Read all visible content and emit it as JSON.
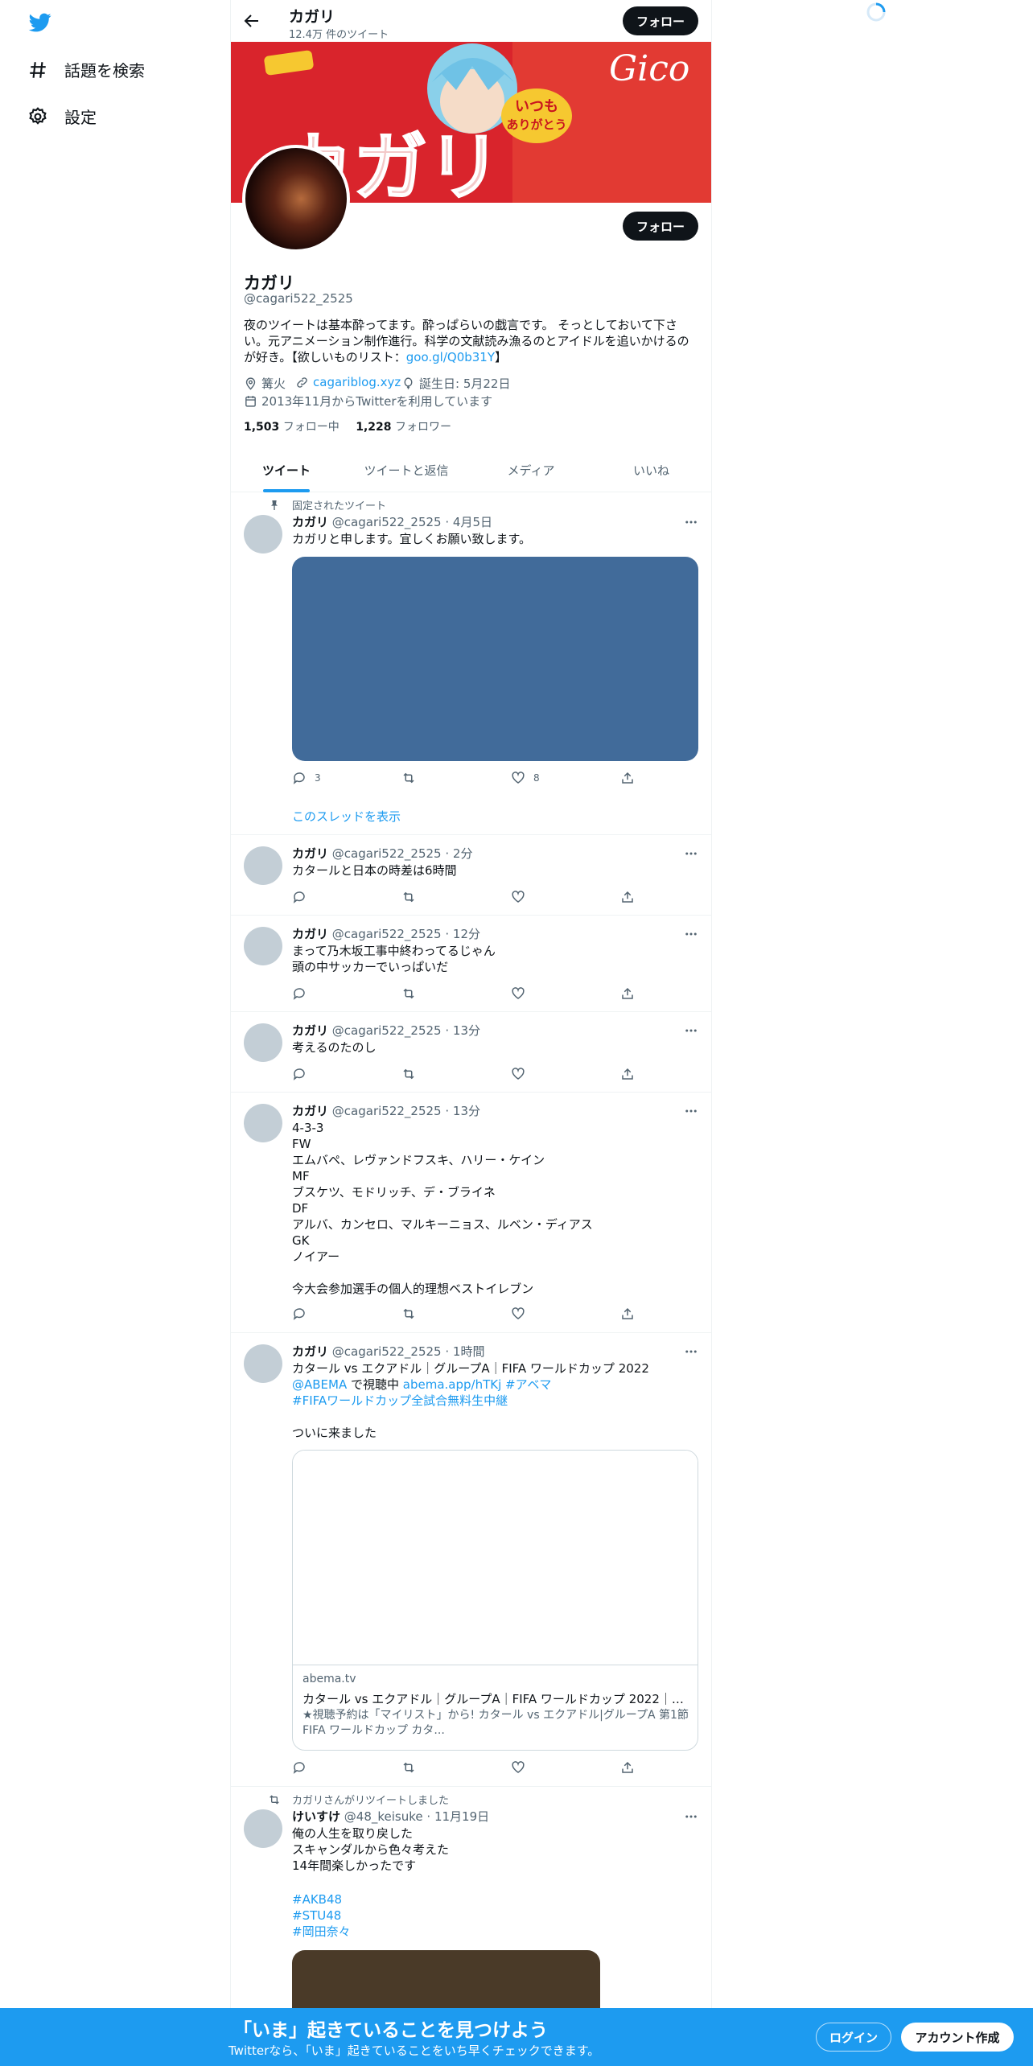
{
  "nav": {
    "explore_label": "話題を検索",
    "settings_label": "設定"
  },
  "header": {
    "name": "カガリ",
    "tweet_count": "12.4万 件のツイート",
    "follow_label": "フォロー"
  },
  "profile": {
    "name": "カガリ",
    "handle": "@cagari522_2525",
    "bio_text": "夜のツイートは基本酔ってます。酔っぱらいの戯言です。 そっとしておいて下さい。元アニメーション制作進行。科学の文献読み漁るのとアイドルを追いかけるのが好き。【欲しいものリスト：",
    "bio_link": "goo.gl/Q0b31Y",
    "bio_end": "】",
    "location": "篝火",
    "url": "cagariblog.xyz",
    "birthday": "誕生日: 5月22日",
    "joined": "2013年11月からTwitterを利用しています",
    "following_count": "1,503",
    "following_label": " フォロー中",
    "followers_count": "1,228",
    "followers_label": " フォロワー",
    "follow_label": "フォロー"
  },
  "tabs": [
    "ツイート",
    "ツイートと返信",
    "メディア",
    "いいね"
  ],
  "tweets": [
    {
      "context": "固定されたツイート",
      "name": "カガリ",
      "handle": "@cagari522_2525",
      "time": "4月5日",
      "text": "カガリと申します。宜しくお願い致します。",
      "replies": "3",
      "likes": "8",
      "thread_link": "このスレッドを表示"
    },
    {
      "name": "カガリ",
      "handle": "@cagari522_2525",
      "time": "2分",
      "text": "カタールと日本の時差は6時間"
    },
    {
      "name": "カガリ",
      "handle": "@cagari522_2525",
      "time": "12分",
      "text": "まって乃木坂工事中終わってるじゃん\n頭の中サッカーでいっぱいだ"
    },
    {
      "name": "カガリ",
      "handle": "@cagari522_2525",
      "time": "13分",
      "text": "考えるのたのし"
    },
    {
      "name": "カガリ",
      "handle": "@cagari522_2525",
      "time": "13分",
      "text": "4-3-3\nFW\nエムバペ、レヴァンドフスキ、ハリー・ケイン\nMF\nブスケツ、モドリッチ、デ・ブライネ\nDF\nアルバ、カンセロ、マルキーニョス、ルベン・ディアス\nGK\nノイアー\n\n今大会参加選手の個人的理想ベストイレブン"
    },
    {
      "name": "カガリ",
      "handle": "@cagari522_2525",
      "time": "1時間",
      "line1": "カタール vs エクアドル｜グループA｜FIFA ワールドカップ 2022",
      "mention": "@ABEMA",
      "line2_mid": " で視聴中 ",
      "link": "abema.app/hTKj",
      "hashtag1": "#アベマ",
      "hashtag2": "#FIFAワールドカップ全試合無料生中継",
      "line4": "ついに来ました",
      "card_domain": "abema.tv",
      "card_title": "カタール vs エクアドル｜グループA｜FIFA ワールドカップ 2022｜新...",
      "card_desc": "★視聴予約は「マイリスト」から! カタール vs エクアドル|グループA 第1節 FIFA ワールドカップ カタ..."
    },
    {
      "context": "カガリさんがリツイートしました",
      "name": "けいすけ",
      "handle": "@48_keisuke",
      "time": "11月19日",
      "text": "俺の人生を取り戻した\nスキャンダルから色々考えた\n14年間楽しかったです",
      "tags": [
        "#AKB48",
        "#STU48",
        "#岡田奈々"
      ]
    }
  ],
  "bottom_bar": {
    "title": "「いま」起きていることを見つけよう",
    "subtitle": "Twitterなら、「いま」起きていることをいち早くチェックできます。",
    "login_label": "ログイン",
    "signup_label": "アカウント作成"
  },
  "colors": {
    "accent": "#1d9bf0",
    "text": "#0f1419",
    "muted": "#536471",
    "banner": "#d6212a"
  }
}
